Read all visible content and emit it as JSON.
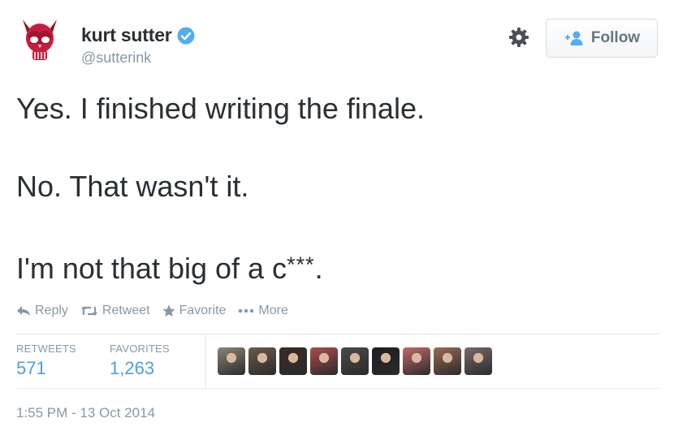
{
  "user": {
    "name": "kurt sutter",
    "handle": "@sutterink",
    "verified": true,
    "follow_label": "Follow"
  },
  "tweet": {
    "line1": "Yes. I finished writing the finale.",
    "line2": "No. That wasn't it.",
    "line3_prefix": "I'm not that big of a c",
    "line3_stars": "***",
    "line3_suffix": "."
  },
  "actions": {
    "reply": "Reply",
    "retweet": "Retweet",
    "favorite": "Favorite",
    "more": "More"
  },
  "stats": {
    "retweets_label": "RETWEETS",
    "retweets_value": "571",
    "favorites_label": "FAVORITES",
    "favorites_value": "1,263"
  },
  "favoriters": [
    {
      "color": "#8a8577"
    },
    {
      "color": "#6b5a4a"
    },
    {
      "color": "#3a2a24"
    },
    {
      "color": "#b04a4a"
    },
    {
      "color": "#4a4a4a"
    },
    {
      "color": "#1e1e22"
    },
    {
      "color": "#c06a6a"
    },
    {
      "color": "#9a6a52"
    },
    {
      "color": "#7a6a6a"
    }
  ],
  "timestamp": "1:55 PM - 13 Oct 2014",
  "colors": {
    "accent": "#4d9ee3",
    "verified": "#55acee",
    "muted": "#8899a6",
    "avatar_red": "#c61d3f"
  }
}
